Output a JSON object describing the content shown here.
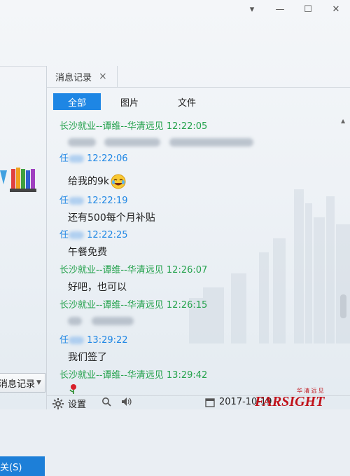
{
  "window": {
    "controls": [
      "▾",
      "—",
      "☐",
      "✕"
    ]
  },
  "left_panel": {
    "message_record_button": "消息记录",
    "bottom_button_fragment": "关(S)"
  },
  "tabs": [
    {
      "label": "消息记录",
      "close": "×"
    }
  ],
  "filters": {
    "all": "全部",
    "images": "图片",
    "files": "文件"
  },
  "messages": [
    {
      "sender": "长沙就业--谭维--华清远见",
      "time": "12:22:05",
      "side": "them",
      "text": ""
    },
    {
      "sender": "任",
      "time": "12:22:06",
      "side": "me",
      "text": "给我的9k"
    },
    {
      "sender": "任",
      "time": "12:22:19",
      "side": "me",
      "text": "还有500每个月补贴"
    },
    {
      "sender": "任",
      "time": "12:22:25",
      "side": "me",
      "text": "午餐免费"
    },
    {
      "sender": "长沙就业--谭维--华清远见",
      "time": "12:26:07",
      "side": "them",
      "text": "好吧，也可以"
    },
    {
      "sender": "长沙就业--谭维--华清远见",
      "time": "12:26:15",
      "side": "them",
      "text": ""
    },
    {
      "sender": "任",
      "time": "13:29:22",
      "side": "me",
      "text": "我们签了"
    },
    {
      "sender": "长沙就业--谭维--华清远见",
      "time": "13:29:42",
      "side": "them",
      "text": ""
    }
  ],
  "bottom_bar": {
    "settings": "设置",
    "date": "2017-10-19"
  },
  "watermark": {
    "top": "华 清 远 见",
    "main": "FARSIGHT",
    "colors": {
      "red": "#c0121a",
      "dark": "#222222"
    }
  },
  "colors": {
    "accent": "#1e86e4",
    "green_sender": "#24a24c",
    "blue_sender": "#1e86e4"
  }
}
